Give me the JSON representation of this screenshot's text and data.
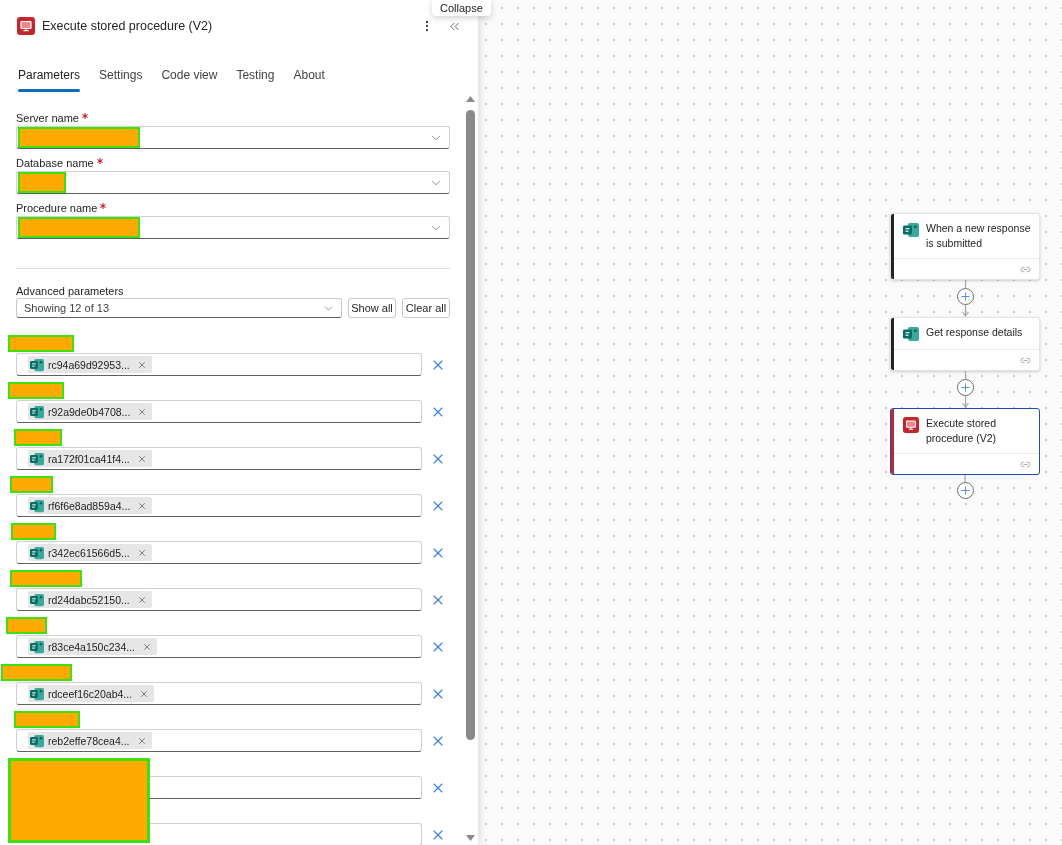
{
  "panel": {
    "title": "Execute stored procedure (V2)",
    "tooltip": "Collapse"
  },
  "tabs": [
    {
      "label": "Parameters",
      "selected": true
    },
    {
      "label": "Settings",
      "selected": false
    },
    {
      "label": "Code view",
      "selected": false
    },
    {
      "label": "Testing",
      "selected": false
    },
    {
      "label": "About",
      "selected": false
    }
  ],
  "fields": [
    {
      "label": "Server name",
      "required": true,
      "redacted": true
    },
    {
      "label": "Database name",
      "required": true,
      "redacted": true
    },
    {
      "label": "Procedure name",
      "required": true,
      "redacted": true
    }
  ],
  "advanced": {
    "label": "Advanced parameters",
    "dropdown_value": "Showing 12 of 13",
    "buttons": [
      "Show all",
      "Clear all"
    ]
  },
  "parameters": [
    {
      "label_redacted": true,
      "token": "rc94a69d92953..."
    },
    {
      "label_redacted": true,
      "token": "r92a9de0b4708..."
    },
    {
      "label_redacted": true,
      "token": "ra172f01ca41f4..."
    },
    {
      "label_redacted": true,
      "token": "rf6f6e8ad859a4..."
    },
    {
      "label_redacted": true,
      "token": "r342ec61566d5..."
    },
    {
      "label_redacted": true,
      "token": "rd24dabc52150..."
    },
    {
      "label_redacted": true,
      "token": "r83ce4a150c234..."
    },
    {
      "label_redacted": true,
      "token": "rdceef16c20ab4..."
    },
    {
      "label_redacted": true,
      "token": "reb2effe78cea4..."
    },
    {
      "covered": true
    },
    {
      "covered": true
    }
  ],
  "flow": {
    "nodes": [
      {
        "title": "When a new response is submitted",
        "kind": "forms",
        "selected": false
      },
      {
        "title": "Get response details",
        "kind": "forms",
        "selected": false
      },
      {
        "title": "Execute stored procedure (V2)",
        "kind": "sql",
        "selected": true
      }
    ]
  }
}
